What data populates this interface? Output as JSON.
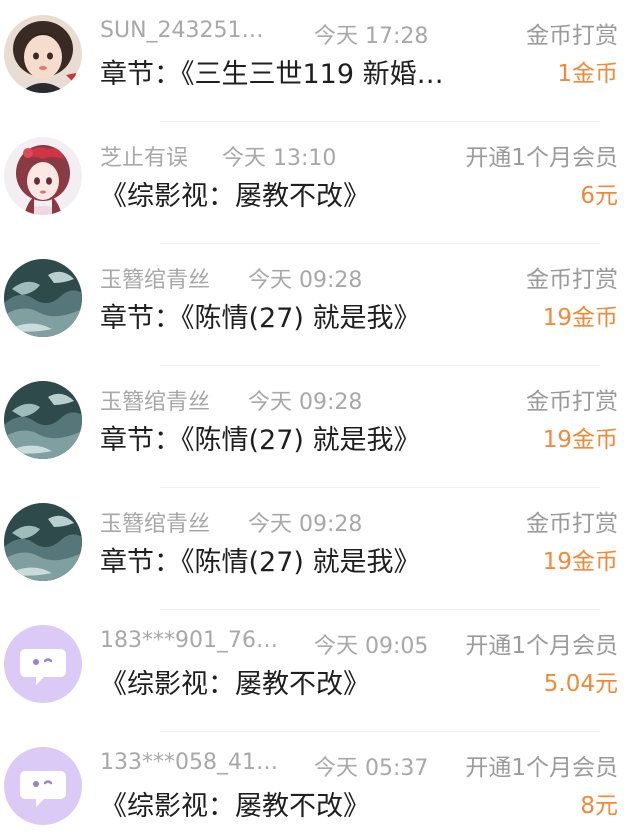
{
  "records": [
    {
      "avatar": "girl-portrait-avatar",
      "username": "SUN_243251…",
      "time": "今天 17:28",
      "action": "金币打赏",
      "title": "章节：《三生三世119  新婚…",
      "amount": "1金币"
    },
    {
      "avatar": "anime-girl-avatar",
      "username": "芝止有误",
      "time": "今天 13:10",
      "action": "开通1个月会员",
      "title": "《综影视：屡教不改》",
      "amount": "6元"
    },
    {
      "avatar": "ocean-wave-avatar",
      "username": "玉簪绾青丝",
      "time": "今天 09:28",
      "action": "金币打赏",
      "title": "章节：《陈情(27)  就是我》",
      "amount": "19金币"
    },
    {
      "avatar": "ocean-wave-avatar",
      "username": "玉簪绾青丝",
      "time": "今天 09:28",
      "action": "金币打赏",
      "title": "章节：《陈情(27)  就是我》",
      "amount": "19金币"
    },
    {
      "avatar": "ocean-wave-avatar",
      "username": "玉簪绾青丝",
      "time": "今天 09:28",
      "action": "金币打赏",
      "title": "章节：《陈情(27)  就是我》",
      "amount": "19金币"
    },
    {
      "avatar": "default-chat-bubble-avatar",
      "username": "183***901_76…",
      "time": "今天 09:05",
      "action": "开通1个月会员",
      "title": "《综影视：屡教不改》",
      "amount": "5.04元"
    },
    {
      "avatar": "default-chat-bubble-avatar",
      "username": "133***058_41…",
      "time": "今天 05:37",
      "action": "开通1个月会员",
      "title": "《综影视：屡教不改》",
      "amount": "8元"
    }
  ],
  "colors": {
    "amount_accent": "#f0893a",
    "meta_text": "#a8a8a8",
    "title_text": "#1f1f1f",
    "default_avatar_bg": "#d9c7f5"
  }
}
